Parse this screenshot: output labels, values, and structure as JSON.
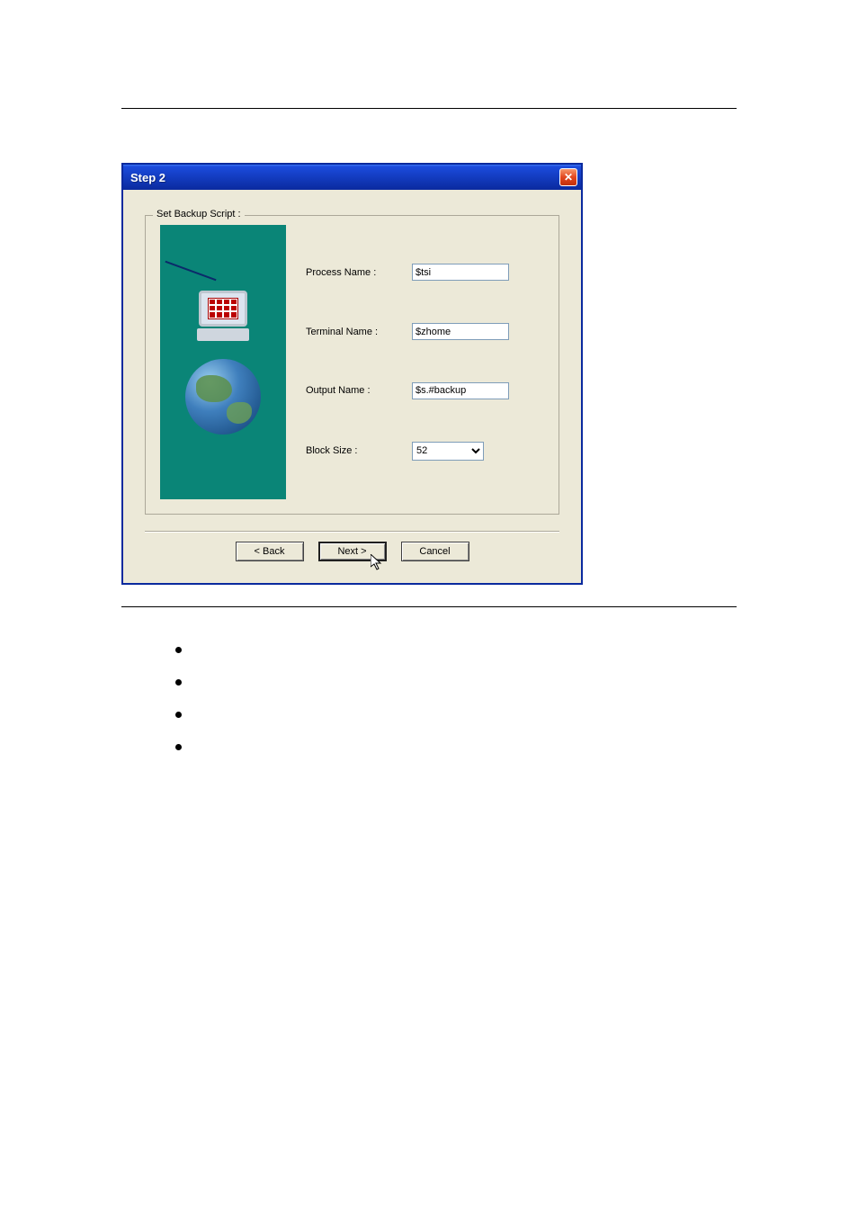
{
  "dialog": {
    "title": "Step 2",
    "close_label": "✕",
    "group_legend": "Set Backup Script :",
    "fields": {
      "process_name": {
        "label": "Process Name :",
        "value": "$tsi"
      },
      "terminal_name": {
        "label": "Terminal Name :",
        "value": "$zhome"
      },
      "output_name": {
        "label": "Output Name :",
        "value": "$s.#backup"
      },
      "block_size": {
        "label": "Block Size :",
        "value": "52"
      }
    },
    "buttons": {
      "back": "< Back",
      "next": "Next >",
      "cancel": "Cancel"
    }
  }
}
